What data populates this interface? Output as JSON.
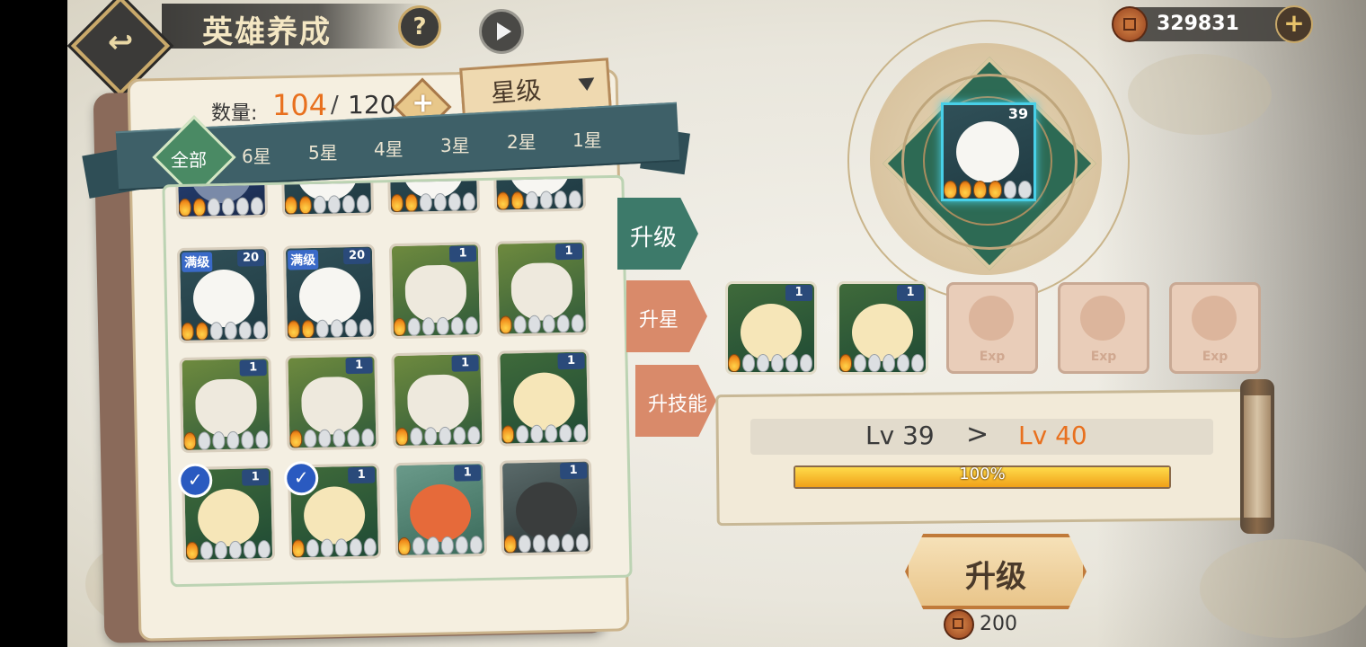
{
  "header": {
    "back_label": "↩",
    "title": "英雄养成",
    "help_label": "?"
  },
  "currency": {
    "amount": "329831",
    "add_label": "+"
  },
  "roster": {
    "count_label": "数量:",
    "count_current": "104",
    "count_separator": "/",
    "count_max": "120",
    "add_label": "+",
    "sort_label": "星级"
  },
  "filters": [
    "全部",
    "6星",
    "5星",
    "4星",
    "3星",
    "2星",
    "1星"
  ],
  "heroes": [
    {
      "type": "mecha",
      "level": "",
      "stars_on": 2,
      "stars_total": 6,
      "max": false,
      "selected": false,
      "partial": true
    },
    {
      "type": "bunny",
      "level": "",
      "stars_on": 2,
      "stars_total": 6,
      "max": false,
      "selected": false,
      "partial": true
    },
    {
      "type": "bunny",
      "level": "",
      "stars_on": 2,
      "stars_total": 6,
      "max": false,
      "selected": false,
      "partial": true
    },
    {
      "type": "bunny",
      "level": "",
      "stars_on": 2,
      "stars_total": 6,
      "max": false,
      "selected": false,
      "partial": true
    },
    {
      "type": "bunny",
      "level": "20",
      "stars_on": 2,
      "stars_total": 6,
      "max": true,
      "max_label": "满级",
      "selected": false
    },
    {
      "type": "bunny",
      "level": "20",
      "stars_on": 2,
      "stars_total": 6,
      "max": true,
      "max_label": "满级",
      "selected": false
    },
    {
      "type": "sage",
      "level": "1",
      "stars_on": 1,
      "stars_total": 6,
      "max": false,
      "selected": false
    },
    {
      "type": "sage",
      "level": "1",
      "stars_on": 1,
      "stars_total": 6,
      "max": false,
      "selected": false
    },
    {
      "type": "sage",
      "level": "1",
      "stars_on": 1,
      "stars_total": 6,
      "max": false,
      "selected": false
    },
    {
      "type": "sage",
      "level": "1",
      "stars_on": 1,
      "stars_total": 6,
      "max": false,
      "selected": false
    },
    {
      "type": "sage",
      "level": "1",
      "stars_on": 1,
      "stars_total": 6,
      "max": false,
      "selected": false
    },
    {
      "type": "bun",
      "level": "1",
      "stars_on": 1,
      "stars_total": 6,
      "max": false,
      "selected": false
    },
    {
      "type": "bun",
      "level": "1",
      "stars_on": 1,
      "stars_total": 6,
      "max": false,
      "selected": true
    },
    {
      "type": "bun",
      "level": "1",
      "stars_on": 1,
      "stars_total": 6,
      "max": false,
      "selected": true
    },
    {
      "type": "crab",
      "level": "1",
      "stars_on": 1,
      "stars_total": 6,
      "max": false,
      "selected": false
    },
    {
      "type": "ninja",
      "level": "1",
      "stars_on": 1,
      "stars_total": 6,
      "max": false,
      "selected": false
    }
  ],
  "side_tabs": [
    "升级",
    "升星",
    "升技能"
  ],
  "selected_hero": {
    "type": "bunny",
    "level": "39",
    "stars_on": 4,
    "stars_total": 6
  },
  "materials": [
    {
      "type": "bun",
      "level": "1",
      "stars_on": 1,
      "stars_total": 6
    },
    {
      "type": "bun",
      "level": "1",
      "stars_on": 1,
      "stars_total": 6
    }
  ],
  "exp_slot_label": "Exp",
  "exp_slot_count": 3,
  "level_up": {
    "from_label": "Lv 39",
    "arrow": ">",
    "to_label": "Lv 40",
    "progress": 1.0,
    "progress_text": "100%"
  },
  "upgrade": {
    "label": "升级",
    "cost": "200"
  }
}
